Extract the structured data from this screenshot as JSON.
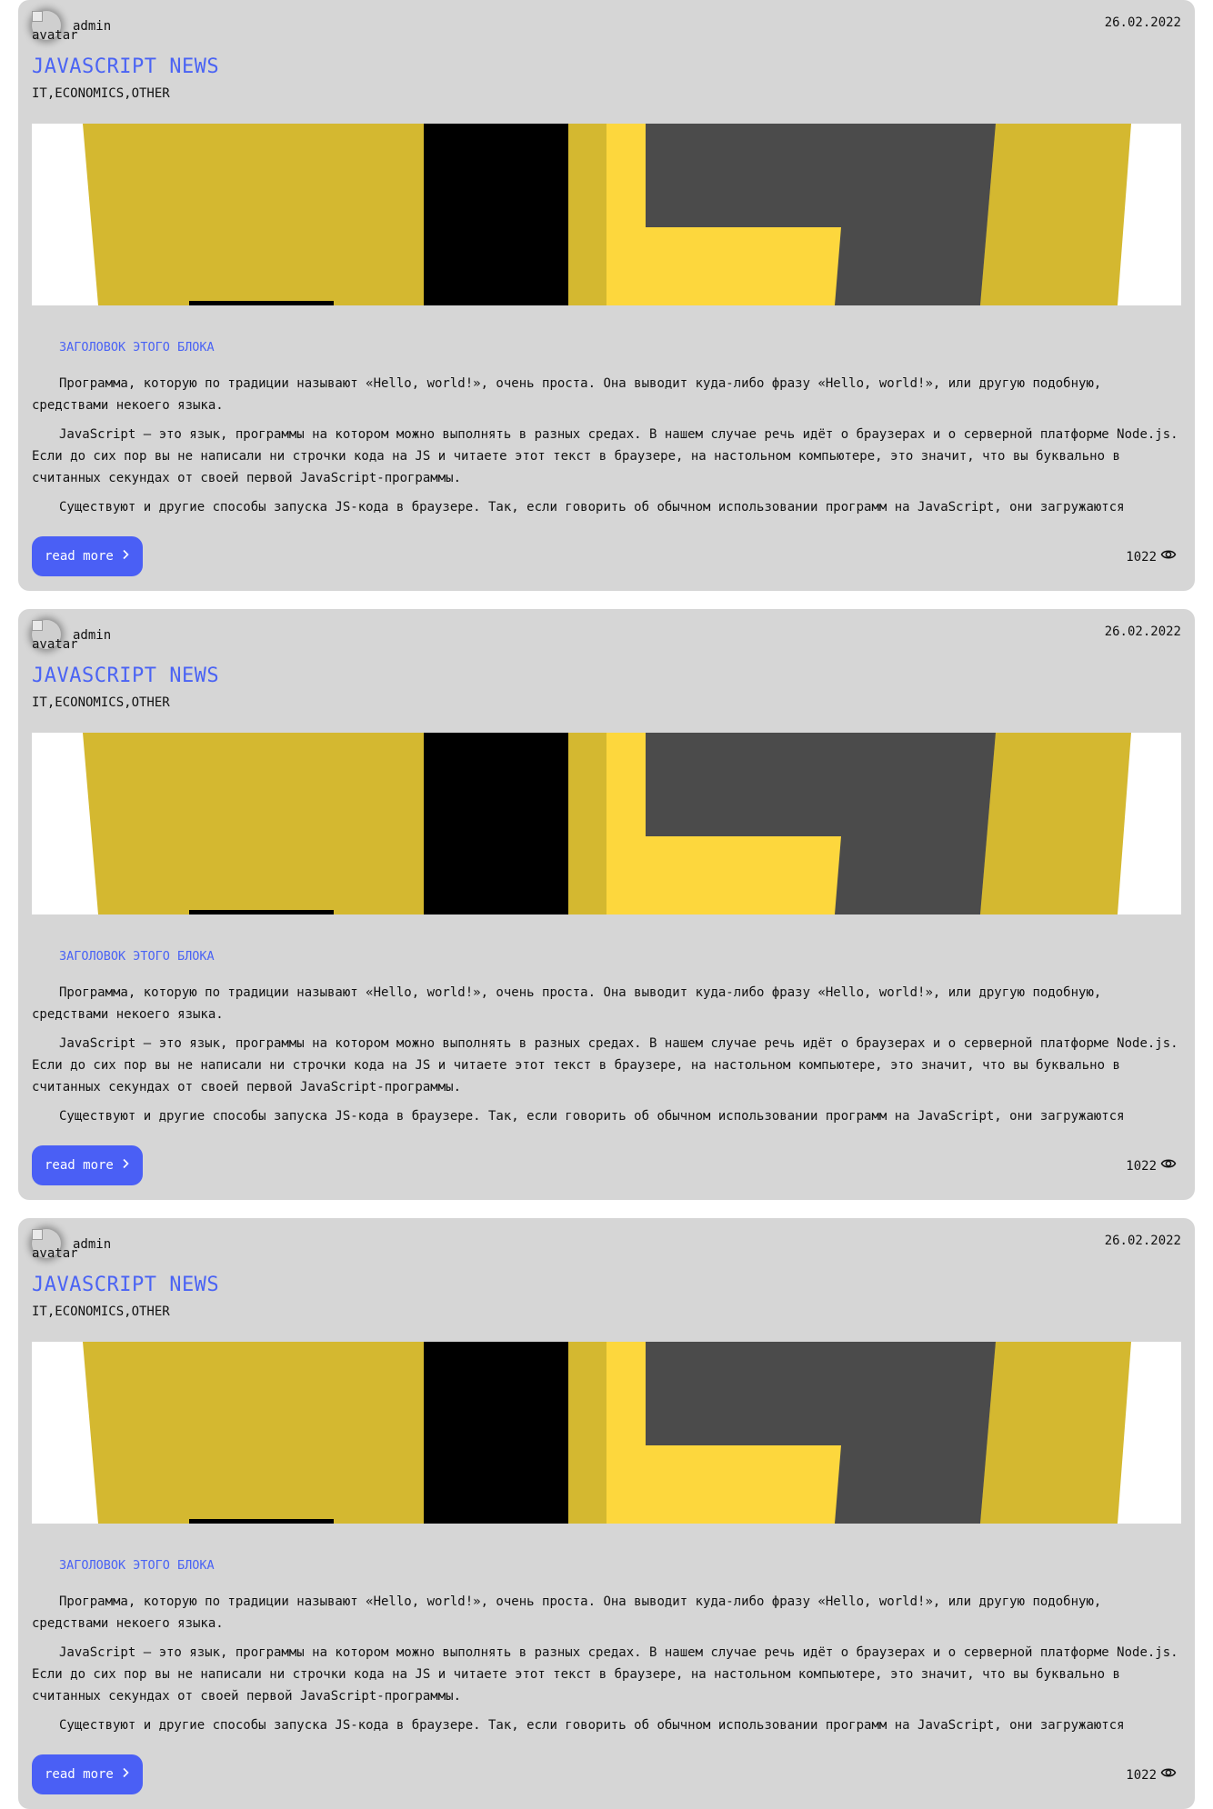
{
  "posts": [
    {
      "author": "admin",
      "avatar_alt": "avatar",
      "date": "26.02.2022",
      "title": "JAVASCRIPT NEWS",
      "tags": "IT,ECONOMICS,OTHER",
      "block_heading": "ЗАГОЛОВОК ЭТОГО БЛОКА",
      "paragraphs": [
        "Программа, которую по традиции называют «Hello, world!», очень проста. Она выводит куда-либо фразу «Hello, world!», или другую подобную, средствами некоего языка.",
        "JavaScript — это язык, программы на котором можно выполнять в разных средах. В нашем случае речь идёт о браузерах и о серверной платформе Node.js. Если до сих пор вы не написали ни строчки кода на JS и читаете этот текст в браузере, на настольном компьютере, это значит, что вы буквально в считанных секундах от своей первой JavaScript-программы.",
        "Существуют и другие способы запуска JS-кода в браузере. Так, если говорить об обычном использовании программ на JavaScript, они загружаются"
      ],
      "read_more_label": "read more",
      "views": "1022"
    },
    {
      "author": "admin",
      "avatar_alt": "avatar",
      "date": "26.02.2022",
      "title": "JAVASCRIPT NEWS",
      "tags": "IT,ECONOMICS,OTHER",
      "block_heading": "ЗАГОЛОВОК ЭТОГО БЛОКА",
      "paragraphs": [
        "Программа, которую по традиции называют «Hello, world!», очень проста. Она выводит куда-либо фразу «Hello, world!», или другую подобную, средствами некоего языка.",
        "JavaScript — это язык, программы на котором можно выполнять в разных средах. В нашем случае речь идёт о браузерах и о серверной платформе Node.js. Если до сих пор вы не написали ни строчки кода на JS и читаете этот текст в браузере, на настольном компьютере, это значит, что вы буквально в считанных секундах от своей первой JavaScript-программы.",
        "Существуют и другие способы запуска JS-кода в браузере. Так, если говорить об обычном использовании программ на JavaScript, они загружаются"
      ],
      "read_more_label": "read more",
      "views": "1022"
    },
    {
      "author": "admin",
      "avatar_alt": "avatar",
      "date": "26.02.2022",
      "title": "JAVASCRIPT NEWS",
      "tags": "IT,ECONOMICS,OTHER",
      "block_heading": "ЗАГОЛОВОК ЭТОГО БЛОКА",
      "paragraphs": [
        "Программа, которую по традиции называют «Hello, world!», очень проста. Она выводит куда-либо фразу «Hello, world!», или другую подобную, средствами некоего языка.",
        "JavaScript — это язык, программы на котором можно выполнять в разных средах. В нашем случае речь идёт о браузерах и о серверной платформе Node.js. Если до сих пор вы не написали ни строчки кода на JS и читаете этот текст в браузере, на настольном компьютере, это значит, что вы буквально в считанных секундах от своей первой JavaScript-программы.",
        "Существуют и другие способы запуска JS-кода в браузере. Так, если говорить об обычном использовании программ на JavaScript, они загружаются"
      ],
      "read_more_label": "read more",
      "views": "1022"
    }
  ],
  "colors": {
    "card_bg": "#d6d6d6",
    "accent": "#4a63f4",
    "button_bg": "#4a5ff5",
    "cover_dark_yellow": "#d4b830",
    "cover_bright_yellow": "#fdd73d",
    "cover_gray": "#4b4b4b",
    "cover_black": "#000000"
  },
  "icons": {
    "read_more": "chevron-right-icon",
    "views": "eye-icon"
  }
}
